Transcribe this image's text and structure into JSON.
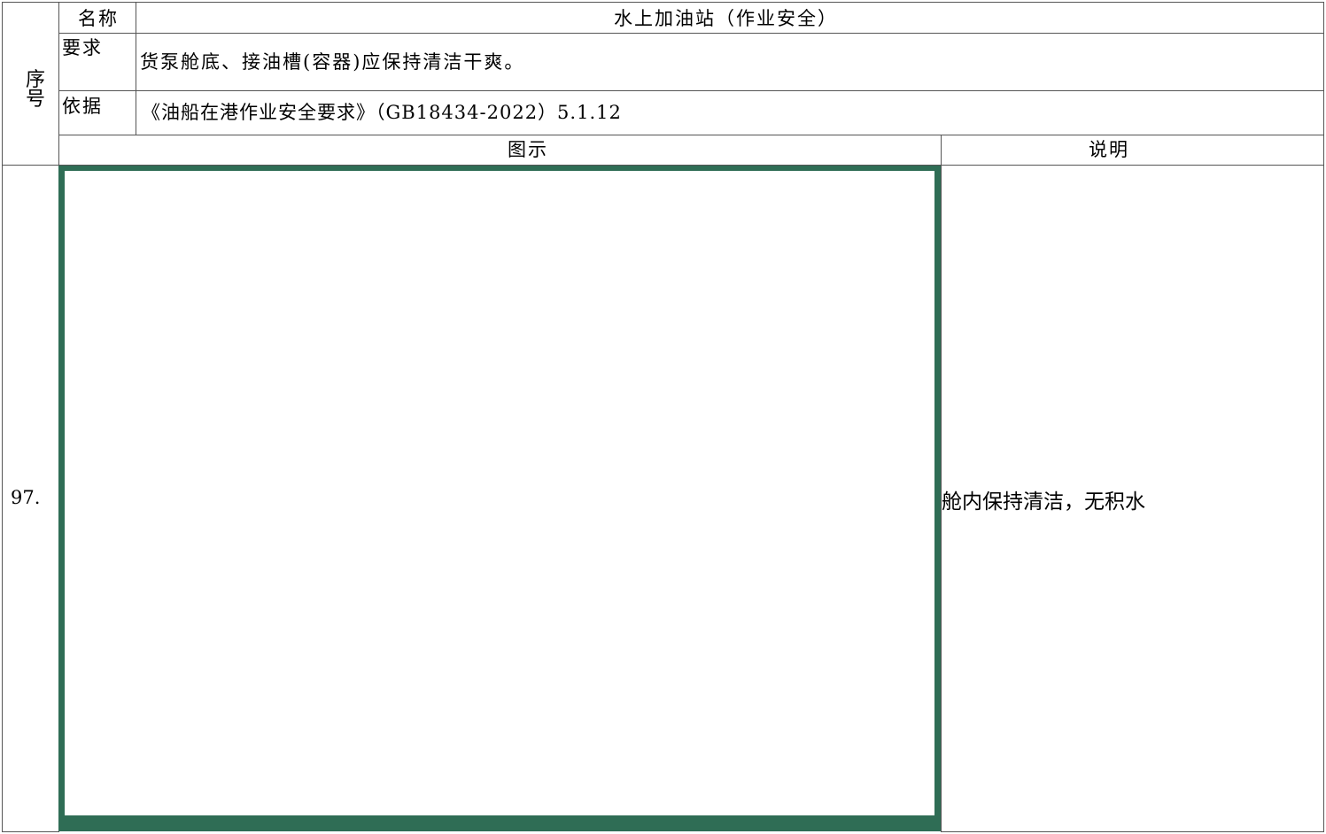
{
  "header": {
    "seq_label": "序号",
    "name_label": "名称",
    "name_value": "水上加油站（作业安全）",
    "requirement_label": "要求",
    "requirement_value": "货泵舱底、接油槽(容器)应保持清洁干爽。",
    "basis_label": "依据",
    "basis_value": "《油船在港作业安全要求》（GB18434-2022）5.1.12"
  },
  "columns": {
    "figure_label": "图示",
    "explanation_label": "说明"
  },
  "row": {
    "number": "97.",
    "explanation": "舱内保持清洁，无积水"
  },
  "colors": {
    "border": "#555555",
    "photo_edge": "#2f6d55"
  }
}
